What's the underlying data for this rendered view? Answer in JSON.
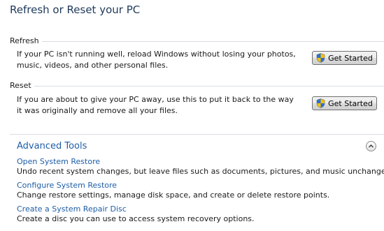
{
  "page": {
    "title": "Refresh or Reset your PC"
  },
  "refresh": {
    "header": "Refresh",
    "description": "If your PC isn't running well, reload Windows without losing your photos, music, videos, and other personal files.",
    "button_label": "Get Started"
  },
  "reset": {
    "header": "Reset",
    "description": "If you are about to give your PC away, use this to put it back to the way it was originally and remove all your files.",
    "button_label": "Get Started"
  },
  "advanced": {
    "title": "Advanced Tools",
    "collapse_icon": "chevron-up-circle-icon",
    "tools": [
      {
        "label": "Open System Restore",
        "description": "Undo recent system changes, but leave files such as documents, pictures, and music unchanged."
      },
      {
        "label": "Configure System Restore",
        "description": "Change restore settings, manage disk space, and create or delete restore points."
      },
      {
        "label": "Create a System Repair Disc",
        "description": "Create a disc you can use to access system recovery options."
      }
    ]
  },
  "colors": {
    "title": "#1e395b",
    "link": "#1e5ea8",
    "divider": "#d8dde4"
  },
  "icons": {
    "button_icon": "shield-icon"
  }
}
